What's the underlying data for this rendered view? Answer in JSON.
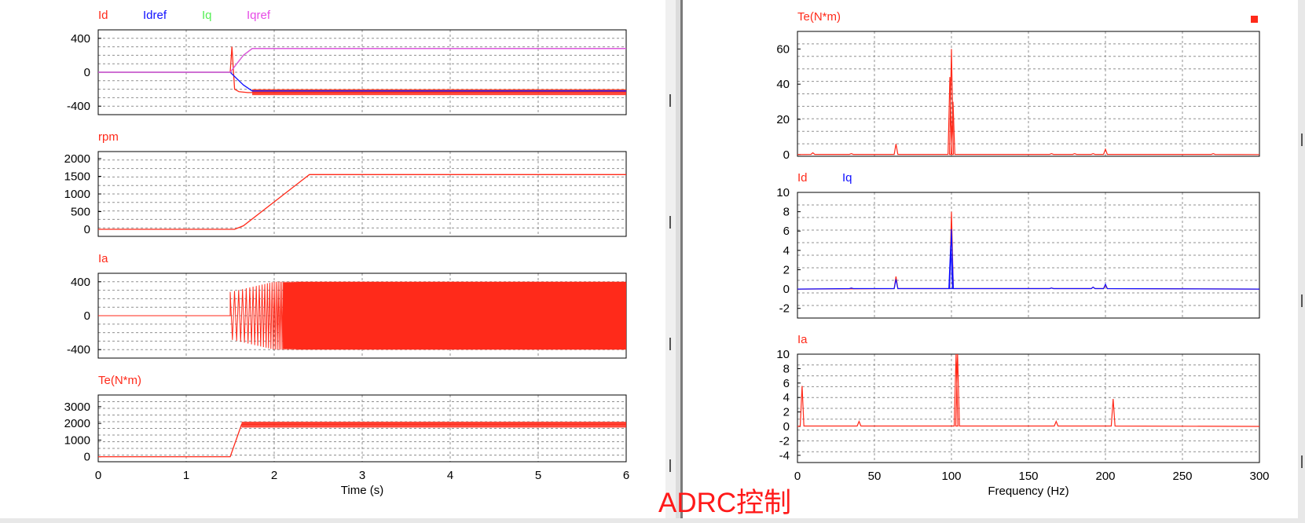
{
  "caption": "ADRC控制",
  "colors": {
    "red": "#ff2a1a",
    "blue": "#1010ff",
    "green": "#55ee55",
    "magenta": "#e64ae6",
    "grid": "#909090",
    "axis": "#000000"
  },
  "chart_data": [
    {
      "type": "line",
      "panel": "time-dq-currents",
      "legend": [
        "Id",
        "Idref",
        "Iq",
        "Iqref"
      ],
      "legend_colors": [
        "#ff2a1a",
        "#1010ff",
        "#55ee55",
        "#e64ae6"
      ],
      "xlim": [
        0,
        6
      ],
      "ylim": [
        -500,
        500
      ],
      "yticks": [
        400,
        0,
        -400
      ],
      "yticklabels": [
        "400",
        "0",
        "-400"
      ],
      "series": [
        {
          "name": "Id",
          "color": "#ff2a1a",
          "x": [
            0,
            1.5,
            1.52,
            1.55,
            1.6,
            1.7,
            6
          ],
          "y": [
            0,
            0,
            300,
            -200,
            -230,
            -240,
            -230
          ],
          "band": [
            1.75,
            6,
            -270,
            -200
          ]
        },
        {
          "name": "Idref",
          "color": "#1010ff",
          "x": [
            0,
            1.5,
            1.65,
            1.75,
            6
          ],
          "y": [
            0,
            0,
            -150,
            -220,
            -220
          ]
        },
        {
          "name": "Iq",
          "color": "#55ee55",
          "x": [
            0,
            1.5,
            1.65,
            1.75,
            6
          ],
          "y": [
            0,
            0,
            200,
            280,
            280
          ]
        },
        {
          "name": "Iqref",
          "color": "#e64ae6",
          "x": [
            0,
            1.5,
            1.65,
            1.75,
            6
          ],
          "y": [
            0,
            0,
            200,
            280,
            280
          ]
        }
      ],
      "grid": true
    },
    {
      "type": "line",
      "panel": "time-speed",
      "legend": [
        "rpm"
      ],
      "legend_colors": [
        "#ff2a1a"
      ],
      "xlim": [
        0,
        6
      ],
      "ylim": [
        -200,
        2200
      ],
      "yticks": [
        2000,
        1500,
        1000,
        500,
        0
      ],
      "yticklabels": [
        "2000",
        "1500",
        "1000",
        "500",
        "0"
      ],
      "series": [
        {
          "name": "rpm",
          "color": "#ff2a1a",
          "x": [
            0,
            1.55,
            1.65,
            2.4,
            6
          ],
          "y": [
            0,
            0,
            100,
            1550,
            1550
          ]
        }
      ],
      "grid": true
    },
    {
      "type": "line",
      "panel": "time-phase-current",
      "legend": [
        "Ia"
      ],
      "legend_colors": [
        "#ff2a1a"
      ],
      "xlim": [
        0,
        6
      ],
      "ylim": [
        -500,
        500
      ],
      "yticks": [
        400,
        0,
        -400
      ],
      "yticklabels": [
        "400",
        "0",
        "-400"
      ],
      "series": [
        {
          "name": "Ia",
          "color": "#ff2a1a",
          "x": [
            0,
            1.5,
            6
          ],
          "y": [
            0,
            0,
            0
          ],
          "oscillation": {
            "start": 1.5,
            "end": 6,
            "amplitude": 400
          }
        }
      ],
      "grid": true
    },
    {
      "type": "line",
      "panel": "time-torque",
      "legend": [
        "Te(N*m)"
      ],
      "legend_colors": [
        "#ff2a1a"
      ],
      "xlim": [
        0,
        6
      ],
      "ylim": [
        -300,
        3700
      ],
      "yticks": [
        3000,
        2000,
        1000,
        0
      ],
      "yticklabels": [
        "3000",
        "2000",
        "1000",
        "0"
      ],
      "xticks": [
        0,
        1,
        2,
        3,
        4,
        5,
        6
      ],
      "xticklabels": [
        "0",
        "1",
        "2",
        "3",
        "4",
        "5",
        "6"
      ],
      "xlabel": "Time (s)",
      "series": [
        {
          "name": "Te(N*m)",
          "color": "#ff2a1a",
          "x": [
            0,
            1.5,
            1.63,
            6
          ],
          "y": [
            0,
            0,
            1950,
            1950
          ],
          "band": [
            1.63,
            6,
            1750,
            2100
          ]
        }
      ],
      "grid": true
    },
    {
      "type": "line",
      "panel": "fft-torque",
      "legend": [
        "Te(N*m)"
      ],
      "legend_colors": [
        "#ff2a1a"
      ],
      "xlim": [
        0,
        300
      ],
      "ylim": [
        -1,
        70
      ],
      "yticks": [
        60,
        40,
        20,
        0
      ],
      "yticklabels": [
        "60",
        "40",
        "20",
        "0"
      ],
      "series": [
        {
          "name": "Te(N*m)",
          "color": "#ff2a1a",
          "peaks": [
            [
              10,
              1
            ],
            [
              35,
              0.5
            ],
            [
              64,
              6
            ],
            [
              99,
              44
            ],
            [
              100,
              60
            ],
            [
              101,
              30
            ],
            [
              165,
              0.5
            ],
            [
              180,
              0.5
            ],
            [
              192,
              0.5
            ],
            [
              200,
              3
            ],
            [
              270,
              0.5
            ]
          ]
        }
      ],
      "grid": true
    },
    {
      "type": "line",
      "panel": "fft-dq-currents",
      "legend": [
        "Id",
        "Iq"
      ],
      "legend_colors": [
        "#ff2a1a",
        "#1010ff"
      ],
      "xlim": [
        0,
        300
      ],
      "ylim": [
        -3,
        10
      ],
      "yticks": [
        10,
        8,
        6,
        4,
        2,
        0,
        -2
      ],
      "yticklabels": [
        "10",
        "8",
        "6",
        "4",
        "2",
        "0",
        "-2"
      ],
      "series": [
        {
          "name": "Id",
          "color": "#ff2a1a",
          "peaks": [
            [
              64,
              1.3
            ],
            [
              100,
              8
            ],
            [
              165,
              0.1
            ],
            [
              192,
              0.2
            ],
            [
              200,
              0.4
            ]
          ]
        },
        {
          "name": "Iq",
          "color": "#1010ff",
          "peaks": [
            [
              35,
              0.1
            ],
            [
              64,
              1
            ],
            [
              99.5,
              4.5
            ],
            [
              100,
              6.2
            ],
            [
              165,
              0.1
            ],
            [
              192,
              0.2
            ],
            [
              200,
              0.5
            ]
          ]
        }
      ],
      "grid": true
    },
    {
      "type": "line",
      "panel": "fft-phase-current",
      "legend": [
        "Ia"
      ],
      "legend_colors": [
        "#ff2a1a"
      ],
      "xlim": [
        0,
        300
      ],
      "ylim": [
        -5,
        10
      ],
      "yticks": [
        10,
        8,
        6,
        4,
        2,
        0,
        -2,
        -4
      ],
      "yticklabels": [
        "10",
        "8",
        "6",
        "4",
        "2",
        "0",
        "-2",
        "-4"
      ],
      "xticks": [
        0,
        50,
        100,
        150,
        200,
        250,
        300
      ],
      "xticklabels": [
        "0",
        "50",
        "100",
        "150",
        "200",
        "250",
        "300"
      ],
      "xlabel": "Frequency (Hz)",
      "series": [
        {
          "name": "Ia",
          "color": "#ff2a1a",
          "peaks": [
            [
              3,
              5.6
            ],
            [
              40,
              0.7
            ],
            [
              103,
              10
            ],
            [
              104,
              10
            ],
            [
              168,
              0.7
            ],
            [
              205,
              3.8
            ]
          ]
        }
      ],
      "grid": true
    }
  ]
}
